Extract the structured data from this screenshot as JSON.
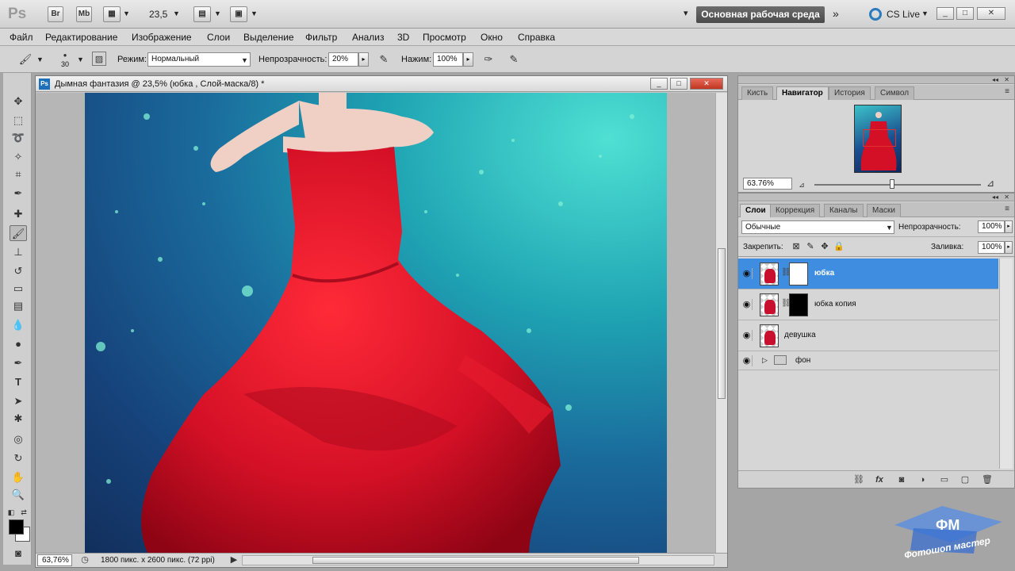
{
  "appbar": {
    "logo": "Ps",
    "br": "Br",
    "mb": "Mb",
    "zoom": "23,5",
    "workspace": "Основная рабочая среда",
    "cs_live": "CS Live"
  },
  "menu": [
    "Файл",
    "Редактирование",
    "Изображение",
    "Слои",
    "Выделение",
    "Фильтр",
    "Анализ",
    "3D",
    "Просмотр",
    "Окно",
    "Справка"
  ],
  "options": {
    "brush_size": "30",
    "mode_label": "Режим:",
    "mode_value": "Нормальный",
    "opacity_label": "Непрозрачность:",
    "opacity_value": "20%",
    "pressure_label": "Нажим:",
    "pressure_value": "100%"
  },
  "document": {
    "title": "Дымная фантазия @ 23,5% (юбка , Слой-маска/8) *",
    "status_zoom": "63,76%",
    "status_info": "1800 пикс. x 2600 пикс. (72 ppi)"
  },
  "navigator": {
    "tabs": [
      "Кисть",
      "Навигатор",
      "История",
      "Символ"
    ],
    "active_tab": "Навигатор",
    "zoom": "63.76%"
  },
  "layers": {
    "tabs": [
      "Слои",
      "Коррекция",
      "Каналы",
      "Маски"
    ],
    "active_tab": "Слои",
    "blend_mode": "Обычные",
    "opacity_label": "Непрозрачность:",
    "opacity_value": "100%",
    "lock_label": "Закрепить:",
    "fill_label": "Заливка:",
    "fill_value": "100%",
    "items": [
      {
        "name": "юбка",
        "selected": true,
        "mask": "white"
      },
      {
        "name": "юбка  копия",
        "selected": false,
        "mask": "black"
      },
      {
        "name": "девушка",
        "selected": false,
        "mask": ""
      },
      {
        "name": "фон",
        "selected": false,
        "mask": "",
        "group": true
      }
    ]
  },
  "watermark": {
    "logo_text": "ФМ",
    "text": "Фотошоп мастер"
  },
  "colors": {
    "selection": "#3e8de0",
    "dress": "#d41026",
    "workspace_btn": "#555555"
  }
}
